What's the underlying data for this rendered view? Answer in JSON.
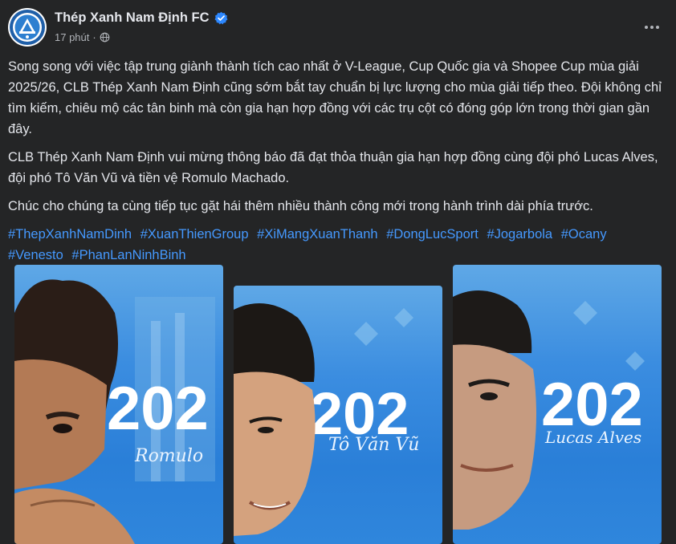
{
  "header": {
    "page_name": "Thép Xanh Nam Định FC",
    "time": "17 phút",
    "separator": "·"
  },
  "body": {
    "paragraphs": [
      "Song song với việc tập trung giành thành tích cao nhất ở V-League, Cup Quốc gia và Shopee Cup mùa giải 2025/26, CLB Thép Xanh Nam Định cũng sớm bắt tay chuẩn bị lực lượng cho mùa giải tiếp theo. Đội không chỉ tìm kiếm, chiêu mộ các tân binh mà còn gia hạn hợp đồng với các trụ cột có đóng góp lớn trong thời gian gần đây.",
      "CLB Thép Xanh Nam Định vui mừng thông báo đã đạt thỏa thuận gia hạn hợp đồng cùng đội phó Lucas Alves, đội phó Tô Văn Vũ và tiền vệ Romulo Machado.",
      "Chúc cho chúng ta cùng tiếp tục gặt hái thêm nhiều thành công mới trong hành trình dài phía trước."
    ],
    "hashtags": [
      "#ThepXanhNamDinh",
      "#XuanThienGroup",
      "#XiMangXuanThanh",
      "#DongLucSport",
      "#Jogarbola",
      "#Ocany",
      "#Venesto",
      "#PhanLanNinhBinh"
    ]
  },
  "images": [
    {
      "year_text": "202",
      "signature": "Romulo"
    },
    {
      "year_text": "202",
      "signature": "Tô Văn Vũ"
    },
    {
      "year_text": "202",
      "signature": "Lucas Alves"
    }
  ],
  "colors": {
    "background": "#242526",
    "text": "#e4e6eb",
    "secondary_text": "#b0b3b8",
    "hashtag": "#4599ff",
    "verified": "#2d88ff",
    "card_blue": "#2f86dc"
  },
  "icons": [
    "club-logo-icon",
    "verified-badge-icon",
    "globe-icon",
    "more-options-icon"
  ]
}
